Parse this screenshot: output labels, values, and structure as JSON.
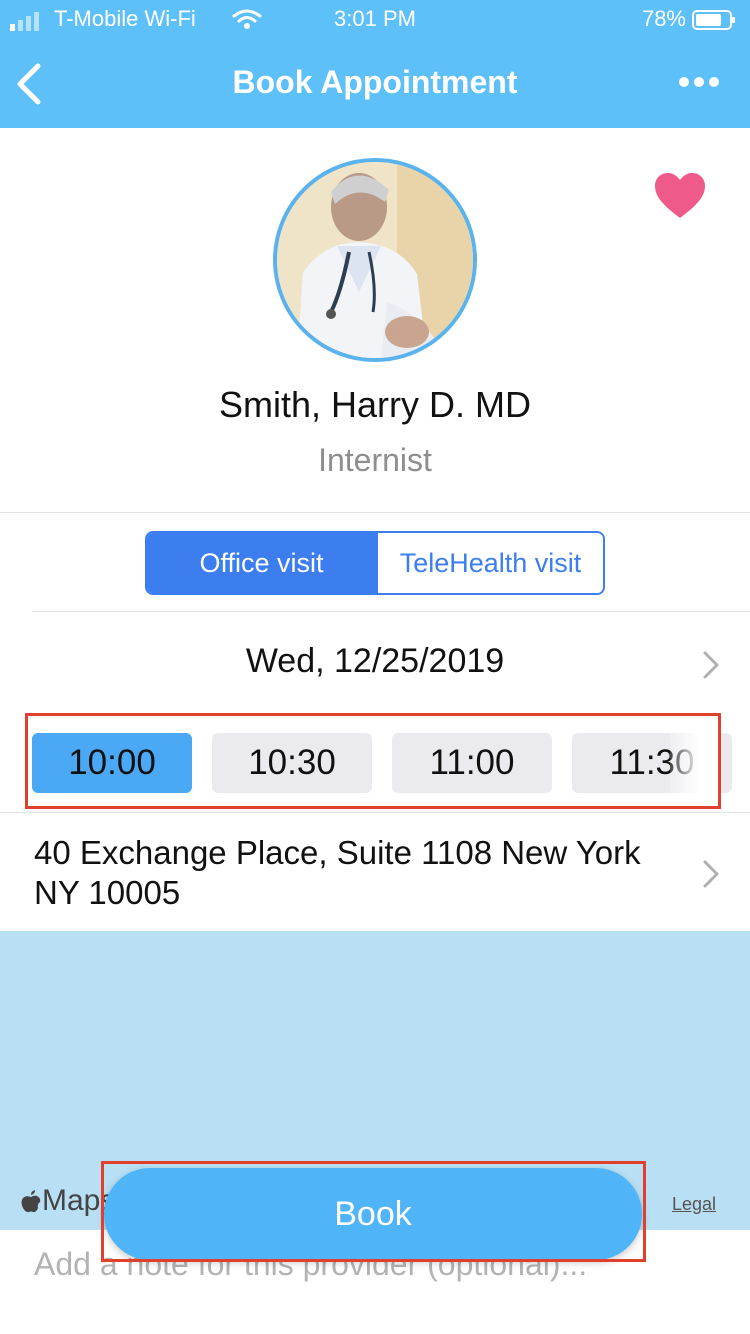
{
  "status_bar": {
    "carrier": "T-Mobile Wi-Fi",
    "time": "3:01 PM",
    "battery": "78%",
    "battery_level": 0.78
  },
  "nav": {
    "title": "Book Appointment",
    "back_icon": "chevron-left-icon",
    "more_icon": "ellipsis-icon"
  },
  "provider": {
    "name": "Smith, Harry D.  MD",
    "specialty": "Internist",
    "favorite_icon": "heart-icon"
  },
  "visit_type": {
    "options": [
      "Office visit",
      "TeleHealth visit"
    ],
    "selected": "Office visit"
  },
  "date": {
    "label": "Wed, 12/25/2019"
  },
  "time_slots": {
    "slots": [
      "10:00",
      "10:30",
      "11:00",
      "11:30"
    ],
    "selected": "10:00"
  },
  "location": {
    "address": "40 Exchange Place, Suite 1108 New York NY 10005"
  },
  "map": {
    "provider_label": "Maps",
    "legal_label": "Legal"
  },
  "note": {
    "placeholder": "Add a note for this provider (optional)..."
  },
  "book_button": {
    "label": "Book"
  },
  "colors": {
    "header": "#5ec0f8",
    "accent": "#3c7eef",
    "selected_slot": "#4aa8f5",
    "book": "#4fb4f8",
    "favorite": "#ee5a8a",
    "highlight": "#e0412d",
    "map": "#b8dff3"
  }
}
